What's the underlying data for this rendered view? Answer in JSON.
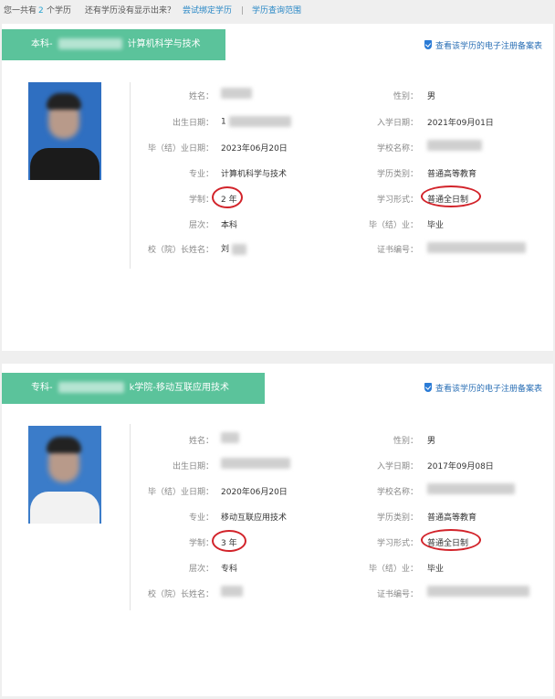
{
  "topbar": {
    "prefix": "您一共有",
    "count": "2",
    "suffix": "个学历",
    "question": "还有学历没有显示出来？",
    "bind_link": "尝试绑定学历",
    "separator": "|",
    "scope_link": "学历查询范围"
  },
  "labels": {
    "name": "姓名：",
    "gender": "性别：",
    "birth": "出生日期：",
    "enroll": "入学日期：",
    "graduate_date": "毕（结）业日期：",
    "school": "学校名称：",
    "major": "专业：",
    "category": "学历类别：",
    "duration": "学制：",
    "form": "学习形式：",
    "level": "层次：",
    "grad_status": "毕（结）业：",
    "principal": "校（院）长姓名：",
    "cert_no": "证书编号："
  },
  "report_link": "查看该学历的电子注册备案表",
  "records": [
    {
      "banner_prefix": "本科-",
      "banner_suffix": "计算机科学与技术",
      "gender": "男",
      "birth": "1",
      "enroll": "2021年09月01日",
      "graduate_date": "2023年06月20日",
      "school": "",
      "major": "计算机科学与技术",
      "category": "普通高等教育",
      "duration": "2 年",
      "form": "普通全日制",
      "level": "本科",
      "grad_status": "毕业",
      "principal": "刘"
    },
    {
      "banner_prefix": "专科-",
      "banner_suffix": "k学院-移动互联应用技术",
      "gender": "男",
      "birth": "",
      "enroll": "2017年09月08日",
      "graduate_date": "2020年06月20日",
      "school": "",
      "major": "移动互联应用技术",
      "category": "普通高等教育",
      "duration": "3 年",
      "form": "普通全日制",
      "level": "专科",
      "grad_status": "毕业",
      "principal": ""
    }
  ],
  "colors": {
    "banner": "#5bc39b",
    "link": "#2a88c6",
    "highlight_ring": "#d2232a"
  }
}
